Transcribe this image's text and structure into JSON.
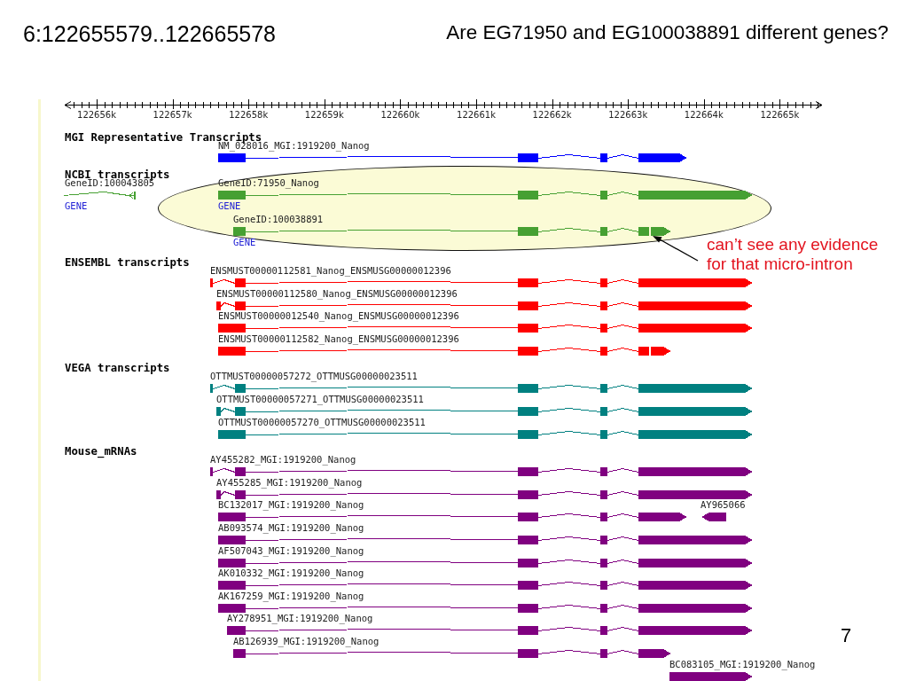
{
  "slide": {
    "location": "6:122655579..122665578",
    "question": "Are EG71950 and EG100038891 different genes?",
    "page_number": "7"
  },
  "browser": {
    "ruler": {
      "labels": [
        "122656k",
        "122657k",
        "122658k",
        "122659k",
        "122660k",
        "122661k",
        "122662k",
        "122663k",
        "122664k",
        "122665k"
      ]
    },
    "tracks": [
      {
        "title": "MGI Representative Transcripts",
        "color": "#0000ff",
        "rows": [
          {
            "features": [
              {
                "label": "NM_028016_MGI:1919200_Nanog",
                "kind": "truncated"
              }
            ]
          }
        ]
      },
      {
        "title": "NCBI transcripts",
        "color": "#46a032",
        "rows": [
          {
            "features": [
              {
                "label": "GeneID:100043805",
                "kind": "thin",
                "link": "GENE"
              },
              {
                "label": "GeneID:71950_Nanog",
                "kind": "full",
                "link": "GENE"
              }
            ]
          },
          {
            "features": [
              {
                "label": "GeneID:100038891",
                "kind": "latesplitend",
                "link": "GENE"
              }
            ]
          }
        ]
      },
      {
        "title": "ENSEMBL transcripts",
        "color": "#ff0000",
        "rows": [
          {
            "features": [
              {
                "label": "ENSMUST00000112581_Nanog_ENSMUSG00000012396",
                "kind": "tickstart"
              }
            ]
          },
          {
            "features": [
              {
                "label": "ENSMUST00000112580_Nanog_ENSMUSG00000012396",
                "kind": "stubstart"
              }
            ]
          },
          {
            "features": [
              {
                "label": "ENSMUST00000012540_Nanog_ENSMUSG00000012396",
                "kind": "full"
              }
            ]
          },
          {
            "features": [
              {
                "label": "ENSMUST00000112582_Nanog_ENSMUSG00000012396",
                "kind": "splitend"
              }
            ]
          }
        ]
      },
      {
        "title": "VEGA transcripts",
        "color": "#008080",
        "rows": [
          {
            "features": [
              {
                "label": "OTTMUST00000057272_OTTMUSG00000023511",
                "kind": "tickstart"
              }
            ]
          },
          {
            "features": [
              {
                "label": "OTTMUST00000057271_OTTMUSG00000023511",
                "kind": "stubstart"
              }
            ]
          },
          {
            "features": [
              {
                "label": "OTTMUST00000057270_OTTMUSG00000023511",
                "kind": "full"
              }
            ]
          }
        ]
      },
      {
        "title": "Mouse_mRNAs",
        "color": "#800080",
        "rows": [
          {
            "features": [
              {
                "label": "AY455282_MGI:1919200_Nanog",
                "kind": "tickstart"
              }
            ]
          },
          {
            "features": [
              {
                "label": "AY455285_MGI:1919200_Nanog",
                "kind": "stubstart"
              }
            ]
          },
          {
            "features": [
              {
                "label": "BC132017_MGI:1919200_Nanog",
                "kind": "truncated"
              },
              {
                "label": "AY965066",
                "kind": "reverse"
              }
            ]
          },
          {
            "features": [
              {
                "label": "AB093574_MGI:1919200_Nanog",
                "kind": "full"
              }
            ]
          },
          {
            "features": [
              {
                "label": "AF507043_MGI:1919200_Nanog",
                "kind": "full"
              }
            ]
          },
          {
            "features": [
              {
                "label": "AK010332_MGI:1919200_Nanog",
                "kind": "full"
              }
            ]
          },
          {
            "features": [
              {
                "label": "AK167259_MGI:1919200_Nanog",
                "kind": "full"
              }
            ]
          },
          {
            "features": [
              {
                "label": "AY278951_MGI:1919200_Nanog",
                "kind": "latestart"
              }
            ]
          },
          {
            "features": [
              {
                "label": "AB126939_MGI:1919200_Nanog",
                "kind": "lateshort"
              }
            ]
          },
          {
            "features": [
              {
                "label": "BC083105_MGI:1919200_Nanog",
                "kind": "single"
              }
            ]
          }
        ]
      }
    ]
  },
  "annotation": {
    "text": "can’t see any evidence for that micro-intron"
  }
}
